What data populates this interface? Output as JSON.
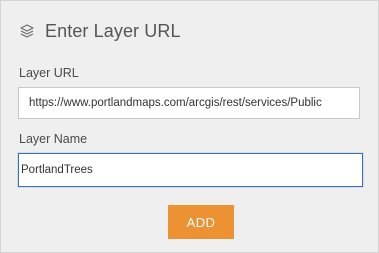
{
  "dialog": {
    "title": "Enter Layer URL",
    "title_icon": "layers-icon"
  },
  "layer_url": {
    "label": "Layer URL",
    "value": "https://www.portlandmaps.com/arcgis/rest/services/Public"
  },
  "layer_name": {
    "label": "Layer Name",
    "value": "PortlandTrees"
  },
  "add_button": {
    "label": "ADD",
    "color": "#ec9232"
  }
}
